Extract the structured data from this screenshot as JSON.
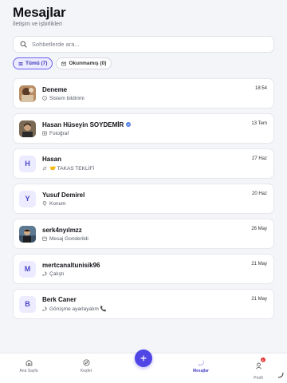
{
  "header": {
    "title": "Mesajlar",
    "subtitle": "İletişim ve işbirlikleri"
  },
  "search": {
    "placeholder": "Sohbetlerde ara...",
    "value": ""
  },
  "filters": [
    {
      "label": "Tümü (7)",
      "active": true
    },
    {
      "label": "Okunmamış (0)",
      "active": false
    }
  ],
  "conversations": [
    {
      "name": "Deneme",
      "preview": "Sistem bildirimi",
      "date": "18:54",
      "avatar": "photo",
      "preview_icon": "info-icon",
      "verified": false
    },
    {
      "name": "Hasan Hüseyin SOYDEMİR",
      "preview": "Fotoğraf",
      "date": "13 Tem",
      "avatar": "photo",
      "preview_icon": "image-icon",
      "verified": true
    },
    {
      "name": "Hasan",
      "preview": "🤝 TAKAS TEKLİFİ",
      "date": "27 Haz",
      "avatar": "H",
      "preview_icon": "swap-icon",
      "verified": false
    },
    {
      "name": "Yusuf Demirel",
      "preview": "Konum",
      "date": "20 Haz",
      "avatar": "Y",
      "preview_icon": "location-icon",
      "verified": false
    },
    {
      "name": "serk4nyılmzz",
      "preview": "Mesaj Gonderildi",
      "date": "26 May",
      "avatar": "photo",
      "preview_icon": "calendar-icon",
      "verified": false
    },
    {
      "name": "mertcanaltunisik96",
      "preview": "Çalıştı",
      "date": "21 May",
      "avatar": "M",
      "preview_icon": "chat-icon",
      "verified": false
    },
    {
      "name": "Berk Caner",
      "preview": "Görüşme ayarlayalım 📞",
      "date": "21 May",
      "avatar": "B",
      "preview_icon": "chat-icon",
      "verified": false
    }
  ],
  "bottom_nav": [
    {
      "label": "Ana Sayfa",
      "icon": "home-icon",
      "active": false
    },
    {
      "label": "Keşfet",
      "icon": "compass-icon",
      "active": false
    },
    {
      "label": "Mesajlar",
      "icon": "chat-bubble-icon",
      "active": true
    },
    {
      "label": "Profil",
      "icon": "user-icon",
      "active": false,
      "badge": "8"
    }
  ],
  "colors": {
    "accent": "#4f46e5",
    "accent_soft": "#ecebff",
    "background": "#f4f5f8",
    "badge": "#e53935"
  }
}
